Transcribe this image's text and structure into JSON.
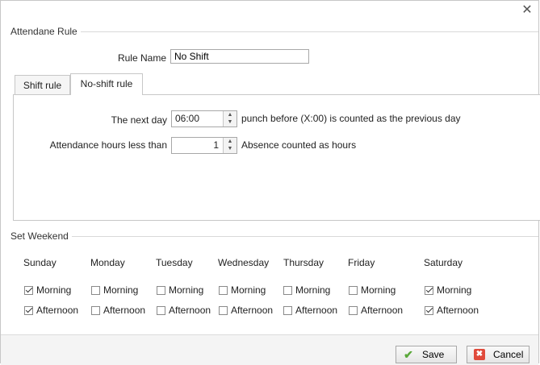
{
  "dialog": {
    "close_glyph": "✕",
    "close_icon": "close-icon"
  },
  "attendance_rule": {
    "legend": "Attendane Rule",
    "rule_name_label": "Rule Name",
    "rule_name_value": "No Shift"
  },
  "tabs": [
    {
      "label": "Shift rule",
      "active": false
    },
    {
      "label": "No-shift rule",
      "active": true
    }
  ],
  "no_shift_rule": {
    "next_day_label": "The next day",
    "next_day_value": "06:00",
    "next_day_desc": "punch before (X:00) is counted as the previous day",
    "hours_label": "Attendance hours less than",
    "hours_value": "1",
    "hours_desc": "Absence counted as hours",
    "spin_up_glyph": "▲",
    "spin_down_glyph": "▼"
  },
  "weekend": {
    "legend": "Set Weekend",
    "days": [
      {
        "name": "Sunday",
        "morning": true,
        "afternoon": true
      },
      {
        "name": "Monday",
        "morning": false,
        "afternoon": false
      },
      {
        "name": "Tuesday",
        "morning": false,
        "afternoon": false
      },
      {
        "name": "Wednesday",
        "morning": false,
        "afternoon": false
      },
      {
        "name": "Thursday",
        "morning": false,
        "afternoon": false
      },
      {
        "name": "Friday",
        "morning": false,
        "afternoon": false
      },
      {
        "name": "Saturday",
        "morning": true,
        "afternoon": true
      }
    ],
    "morning_label": "Morning",
    "afternoon_label": "Afternoon"
  },
  "footer": {
    "save_label": "Save",
    "cancel_label": "Cancel",
    "save_glyph": "✔",
    "cancel_glyph": "✖",
    "save_color": "#5aa83a",
    "cancel_color": "#e04a3b"
  }
}
